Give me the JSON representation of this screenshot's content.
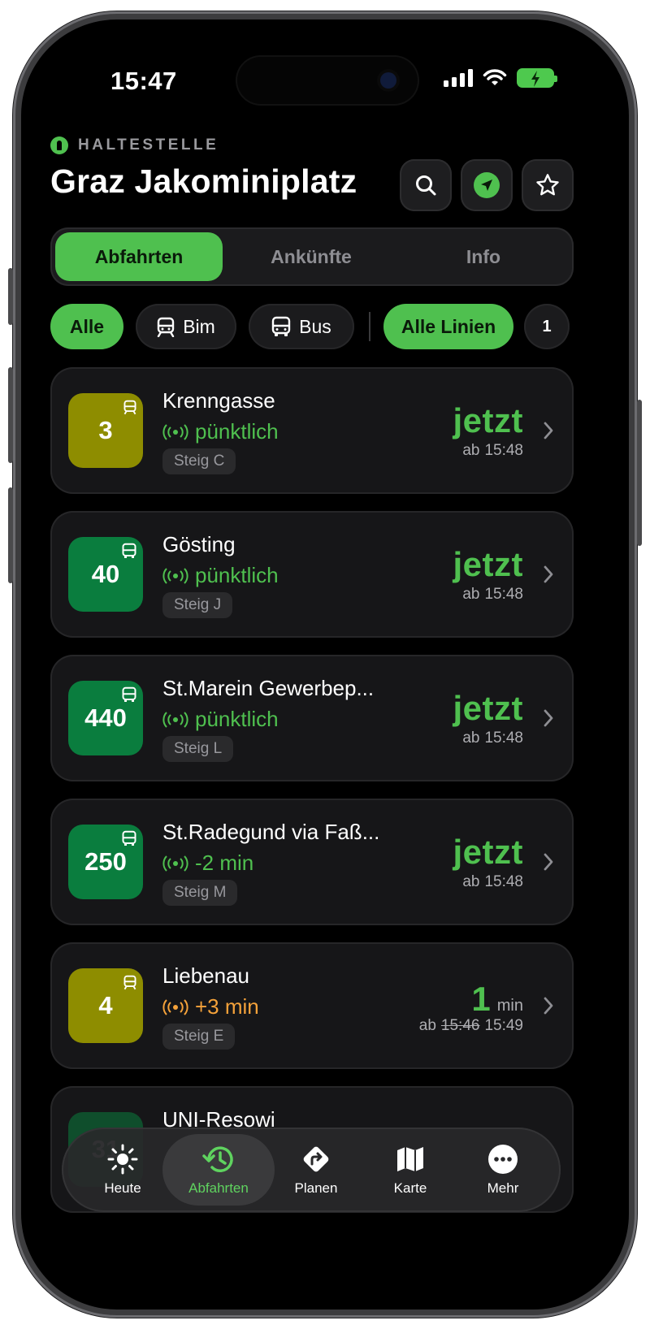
{
  "status_bar": {
    "time": "15:47"
  },
  "header": {
    "stop_caption": "HALTESTELLE",
    "stop_name": "Graz Jakominiplatz"
  },
  "tabs": [
    {
      "label": "Abfahrten",
      "active": true
    },
    {
      "label": "Ankünfte",
      "active": false
    },
    {
      "label": "Info",
      "active": false
    }
  ],
  "filters": {
    "all": "Alle",
    "tram": "Bim",
    "bus": "Bus",
    "lines": "Alle Linien",
    "count": "1"
  },
  "departures": [
    {
      "line": "3",
      "type": "tram",
      "destination": "Krenngasse",
      "status": "pünktlich",
      "status_color": "#4fc04f",
      "platform": "Steig C",
      "when": "jetzt",
      "time_prefix": "ab",
      "time": "15:48"
    },
    {
      "line": "40",
      "type": "bus",
      "destination": "Gösting",
      "status": "pünktlich",
      "status_color": "#4fc04f",
      "platform": "Steig J",
      "when": "jetzt",
      "time_prefix": "ab",
      "time": "15:48"
    },
    {
      "line": "440",
      "type": "bus",
      "destination": "St.Marein Gewerbep...",
      "status": "pünktlich",
      "status_color": "#4fc04f",
      "platform": "Steig L",
      "when": "jetzt",
      "time_prefix": "ab",
      "time": "15:48"
    },
    {
      "line": "250",
      "type": "bus",
      "destination": "St.Radegund via Faß...",
      "status": "-2 min",
      "status_color": "#4fc04f",
      "platform": "Steig M",
      "when": "jetzt",
      "time_prefix": "ab",
      "time": "15:48"
    },
    {
      "line": "4",
      "type": "tram",
      "destination": "Liebenau",
      "status": "+3 min",
      "status_color": "#f5a23a",
      "platform": "Steig E",
      "when_number": "1",
      "when_unit": "min",
      "time_prefix": "ab",
      "time_scheduled": "15:46",
      "time": "15:49"
    },
    {
      "line": "31",
      "type": "bus",
      "destination": "UNI-Resowi"
    }
  ],
  "tab_bar": [
    {
      "label": "Heute",
      "icon": "sun-icon"
    },
    {
      "label": "Abfahrten",
      "icon": "clock-history-icon",
      "active": true
    },
    {
      "label": "Planen",
      "icon": "route-icon"
    },
    {
      "label": "Karte",
      "icon": "map-icon"
    },
    {
      "label": "Mehr",
      "icon": "more-icon"
    }
  ],
  "colors": {
    "accent": "#4fc04f",
    "tram_badge": "#8e8d00",
    "bus_badge": "#0a7d3e",
    "delay": "#f5a23a"
  }
}
